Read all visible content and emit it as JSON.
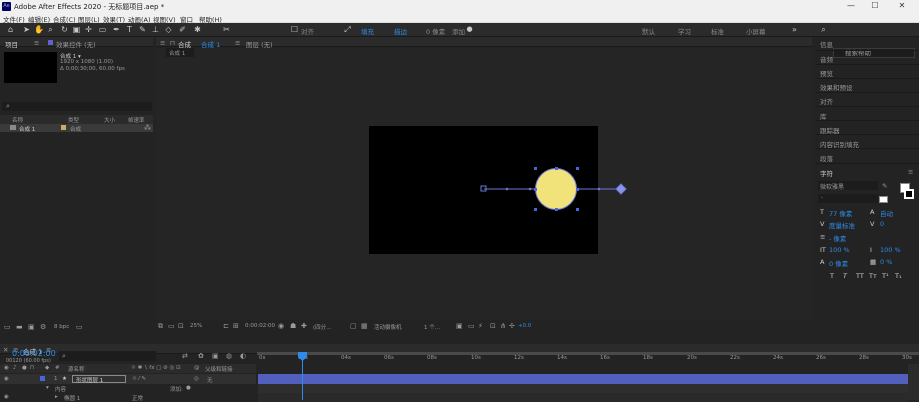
{
  "titlebar": {
    "title": "Adobe After Effects 2020 - 无标题项目.aep *",
    "logo": "Ae",
    "min": "—",
    "max": "☐",
    "close": "✕"
  },
  "menu": [
    "文件(F)",
    "编辑(E)",
    "合成(C)",
    "图层(L)",
    "效果(T)",
    "动画(A)",
    "视图(V)",
    "窗口",
    "帮助(H)"
  ],
  "toolbar": {
    "align_label": "对齐",
    "fill_label": "填充",
    "stroke_label": "描边",
    "stroke_px": "0 像素",
    "add_label": "添加",
    "workspaces": [
      "默认",
      "学习",
      "标准",
      "小屏幕"
    ],
    "search_placeholder": "搜索帮助",
    "colors": {
      "fill": "#f2e27a",
      "stroke": "#ffffff"
    }
  },
  "project": {
    "tab": "项目",
    "effects_tab": "效果控件 (无)",
    "comp_name": "合成 1 ▾",
    "comp_info1": "1920 x 1080 (1.00)",
    "comp_info2": "Δ 0;00;30;00, 60.00 fps",
    "search_icon": "⌕",
    "col_name": "名称",
    "col_type": "类型",
    "col_size": "大小",
    "col_rate": "帧速率",
    "row_name": "合成 1",
    "row_type": "合成",
    "bpc": "8 bpc"
  },
  "composition": {
    "tab_label": "合成",
    "tab_name": "合成 1",
    "layer_tab": "图层 (无)",
    "subtab": "合成 1",
    "zoom": "25%",
    "time": "0:00:02:00",
    "res": "(四分...",
    "camera": "活动摄像机",
    "views": "1 个...",
    "exposure": "+0.0",
    "colors": {
      "ball": "#f2e27a",
      "path": "#6b78d8"
    }
  },
  "right_panel": {
    "items": [
      "信息",
      "音频",
      "预览",
      "效果和预设",
      "对齐",
      "库",
      "跟踪器",
      "内容识别填充",
      "段落"
    ],
    "char_title": "字符",
    "font_name": "微软雅黑",
    "font_style": "-",
    "size": "77 像素",
    "leading": "自动",
    "kerning": "度量标准",
    "tracking": "0",
    "stroke_w": "- 像素",
    "v_scale": "100 %",
    "h_scale": "100 %",
    "baseline": "0 像素",
    "tsume": "0 %",
    "styles": [
      "T",
      "T",
      "TT",
      "Tт",
      "T¹",
      "T₁"
    ]
  },
  "timeline": {
    "comp_tab": "合成 1",
    "timecode": "0:00:02:00",
    "frames": "00120 (60.00 fps)",
    "col_source": "源名称",
    "col_parent": "父级和链接",
    "layer_num": "1",
    "layer_name": "形状图层 1",
    "parent_val": "无",
    "content_label": "内容",
    "add_label": "添加:",
    "ellipse_label": "椭圆 1",
    "mode_val": "正常",
    "ruler": [
      "0s",
      "02s",
      "04s",
      "06s",
      "08s",
      "10s",
      "12s",
      "14s",
      "16s",
      "18s",
      "20s",
      "22s",
      "24s",
      "26s",
      "28s",
      "30s"
    ]
  }
}
